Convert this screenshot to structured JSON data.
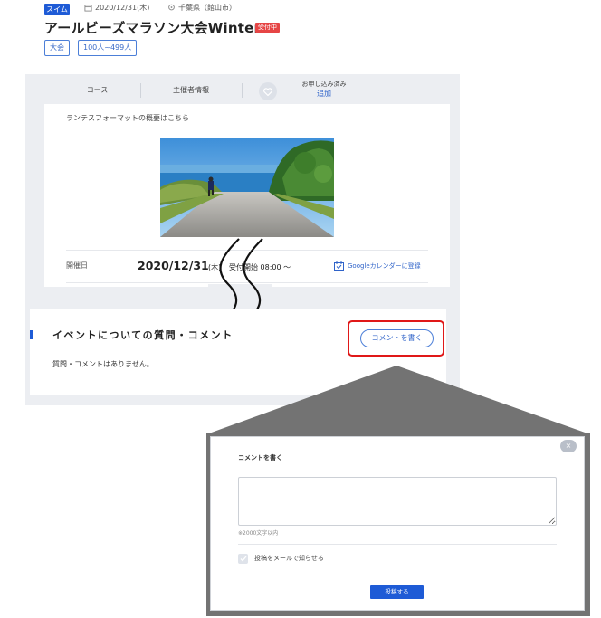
{
  "header": {
    "sport_badge": "スイム",
    "date": "2020/12/31(木)",
    "location": "千葉県（館山市）",
    "title": "アールビーズマラソン大会Winter",
    "status": "受付中",
    "tags": [
      "大会",
      "100人~499人"
    ]
  },
  "tabs": {
    "course": "コース",
    "organizer": "主催者情報",
    "favorite_label": "お申し込み済み",
    "favorite_link": "追加"
  },
  "summary": {
    "text": "ランテスフォーマットの概要はこちら"
  },
  "schedule": {
    "label": "開催日",
    "date": "2020/12/31",
    "day_of_week": "(木)",
    "reception": "受付開始 08:00 ～",
    "calendar_link": "Googleカレンダーに登録"
  },
  "comments": {
    "title": "イベントについての質問・コメント",
    "empty_text": "質問・コメントはありません。",
    "write_button": "コメントを書く"
  },
  "modal": {
    "close": "×",
    "title": "コメントを書く",
    "textarea_value": "",
    "limit_note": "※2000文字以内",
    "notify_label": "投稿をメールで知らせる",
    "submit": "投稿する"
  },
  "colors": {
    "accent": "#1e5bd6",
    "status": "#e64545",
    "highlight": "#e01818"
  }
}
